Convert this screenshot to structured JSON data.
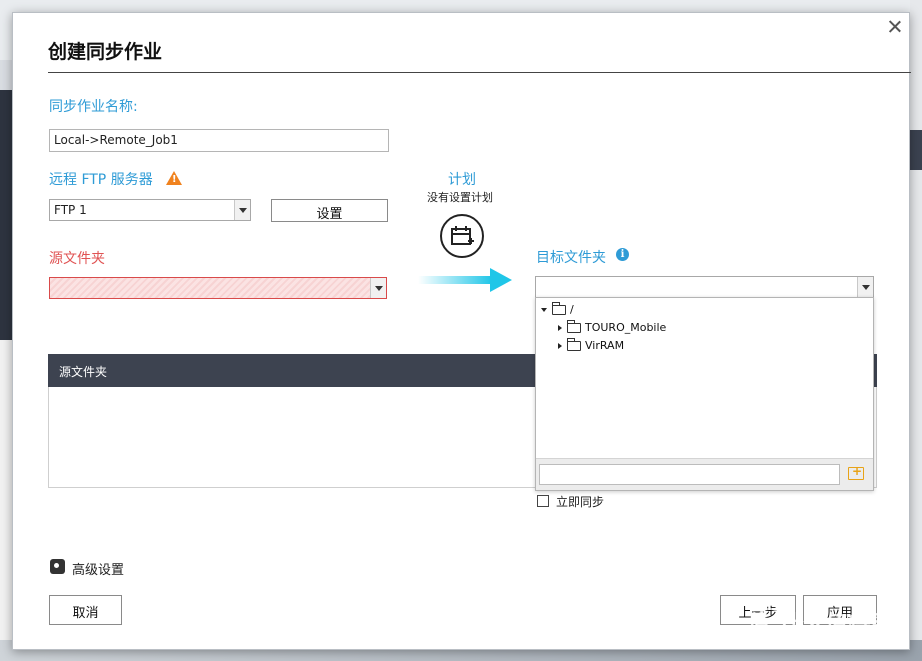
{
  "dialog": {
    "title": "创建同步作业",
    "job_name_label": "同步作业名称:",
    "job_name_value": "Local->Remote_Job1",
    "ftp_label": "远程 FTP 服务器",
    "ftp_selected": "FTP 1",
    "settings_button": "设置",
    "schedule_label": "计划",
    "schedule_status": "没有设置计划",
    "source_label": "源文件夹",
    "target_label": "目标文件夹",
    "table_header": "源文件夹",
    "tree": {
      "root": "/",
      "children": [
        "TOURO_Mobile",
        "VirRAM"
      ]
    },
    "sync_now_label": "立即同步",
    "advanced_label": "高级设置",
    "cancel_button": "取消",
    "back_button": "上一步",
    "apply_button": "应用"
  },
  "colors": {
    "accent": "#2e9bd6",
    "warning": "#f0821e",
    "header_dark": "#3d4350",
    "arrow": "#1fc6e8"
  },
  "watermark": "值 什么值得买"
}
